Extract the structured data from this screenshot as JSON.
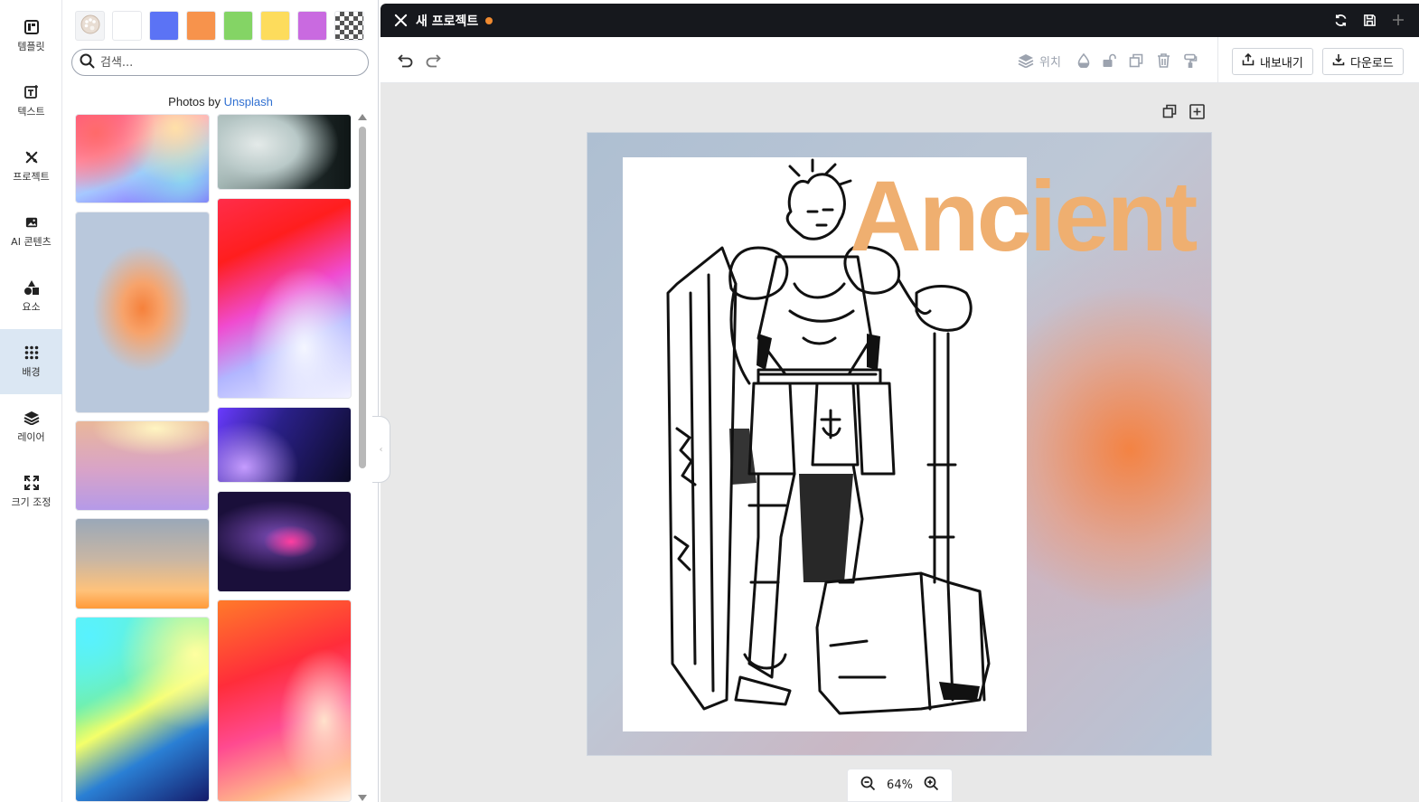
{
  "sidebar": {
    "items": [
      {
        "label": "템플릿",
        "icon": "template-icon"
      },
      {
        "label": "텍스트",
        "icon": "text-icon"
      },
      {
        "label": "프로젝트",
        "icon": "project-icon"
      },
      {
        "label": "AI 콘텐츠",
        "icon": "ai-image-icon"
      },
      {
        "label": "요소",
        "icon": "shapes-icon"
      },
      {
        "label": "배경",
        "icon": "grid-dots-icon",
        "active": true
      },
      {
        "label": "레이어",
        "icon": "layers-icon"
      },
      {
        "label": "크기 조정",
        "icon": "resize-icon"
      }
    ]
  },
  "panel": {
    "swatches": [
      "palette",
      "#ffffff",
      "#5b73f5",
      "#f7934c",
      "#84d465",
      "#fddc5c",
      "#c96ae0",
      "transparent"
    ],
    "search": {
      "placeholder": "검색..."
    },
    "credit": {
      "prefix": "Photos by",
      "link": "Unsplash"
    },
    "thumbnails": 11
  },
  "header": {
    "title": "새 프로젝트",
    "status_color": "#f08a30"
  },
  "toolbar": {
    "position_label": "위치",
    "export_label": "내보내기",
    "download_label": "다운로드"
  },
  "canvas": {
    "headline": "Ancient",
    "headline_color": "#efaf70"
  },
  "zoom": {
    "value": "64%"
  }
}
